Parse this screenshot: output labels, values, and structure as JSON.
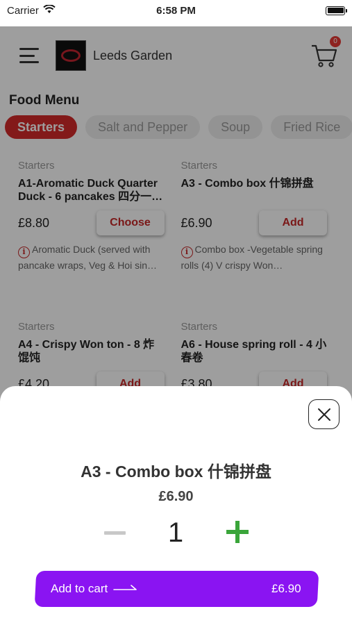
{
  "status_bar": {
    "carrier": "Carrier",
    "time": "6:58 PM"
  },
  "header": {
    "restaurant_name": "Leeds Garden",
    "cart_count": "0"
  },
  "menu": {
    "title": "Food Menu",
    "categories": [
      {
        "label": "Starters",
        "active": true
      },
      {
        "label": "Salt and Pepper",
        "active": false
      },
      {
        "label": "Soup",
        "active": false
      },
      {
        "label": "Fried Rice",
        "active": false
      }
    ],
    "items": [
      {
        "category": "Starters",
        "title": "A1-Aromatic Duck Quarter Duck - 6 pancakes 四分一…",
        "price": "£8.80",
        "button": "Choose",
        "description": "Aromatic Duck (served with pancake wraps, Veg & Hoi sin…"
      },
      {
        "category": "Starters",
        "title": "A3 - Combo box 什锦拼盘",
        "price": "£6.90",
        "button": "Add",
        "description": "Combo box -Vegetable spring rolls (4) V crispy Won…"
      },
      {
        "category": "Starters",
        "title": "A4 - Crispy Won ton - 8 炸馄饨",
        "price": "£4.20",
        "button": "Add",
        "description": ""
      },
      {
        "category": "Starters",
        "title": "A6 - House spring roll - 4 小春卷",
        "price": "£3.80",
        "button": "Add",
        "description": ""
      }
    ]
  },
  "sheet": {
    "title": "A3 - Combo box 什锦拼盘",
    "price": "£6.90",
    "quantity": "1",
    "add_to_cart_label": "Add to cart",
    "add_to_cart_amount": "£6.90"
  },
  "colors": {
    "accent": "#d42b2b",
    "cart_button": "#8a14f2",
    "plus": "#3aa53a"
  }
}
